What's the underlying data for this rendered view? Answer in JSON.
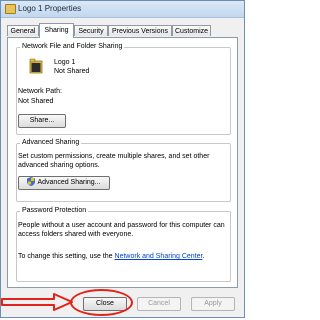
{
  "window": {
    "title": "Logo 1 Properties"
  },
  "tabs": [
    {
      "label": "General"
    },
    {
      "label": "Sharing"
    },
    {
      "label": "Security"
    },
    {
      "label": "Previous Versions"
    },
    {
      "label": "Customize"
    }
  ],
  "network_sharing": {
    "group_title": "Network File and Folder Sharing",
    "item_name": "Logo 1",
    "item_status": "Not Shared",
    "path_label": "Network Path:",
    "path_value": "Not Shared",
    "share_button": "Share..."
  },
  "advanced_sharing": {
    "group_title": "Advanced Sharing",
    "description": "Set custom permissions, create multiple shares, and set other advanced sharing options.",
    "button": "Advanced Sharing..."
  },
  "password_protection": {
    "group_title": "Password Protection",
    "description": "People without a user account and password for this computer can access folders shared with everyone.",
    "change_text": "To change this setting, use the",
    "link_text": "Network and Sharing Center",
    "link_suffix": "."
  },
  "footer": {
    "close_button": "Close",
    "cancel_button": "Cancel",
    "apply_button": "Apply"
  },
  "colors": {
    "annotation": "#e2231a",
    "link": "#0044cc"
  },
  "icons": {
    "folder": "folder-icon",
    "shield": "shield-icon"
  }
}
